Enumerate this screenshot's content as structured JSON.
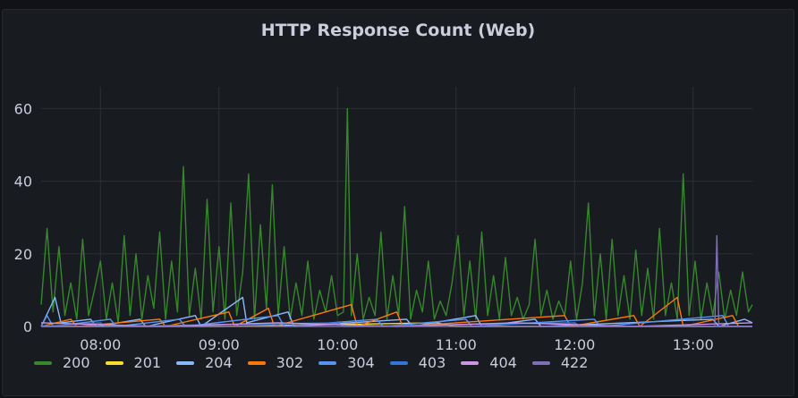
{
  "panel": {
    "title": "HTTP Response Count (Web)"
  },
  "chart_data": {
    "type": "line",
    "title": "HTTP Response Count (Web)",
    "xlabel": "",
    "ylabel": "",
    "ylim": [
      0,
      66
    ],
    "yticks": [
      0,
      20,
      40,
      60
    ],
    "xlim": [
      "07:30",
      "13:30"
    ],
    "xticks": [
      "08:00",
      "09:00",
      "10:00",
      "11:00",
      "12:00",
      "13:00"
    ],
    "grid": true,
    "legend_position": "bottom-left",
    "series": [
      {
        "name": "200",
        "color": "#37872d",
        "points": [
          [
            "07:30",
            6
          ],
          [
            "07:33",
            27
          ],
          [
            "07:36",
            4
          ],
          [
            "07:39",
            22
          ],
          [
            "07:42",
            3
          ],
          [
            "07:45",
            12
          ],
          [
            "07:48",
            2
          ],
          [
            "07:51",
            24
          ],
          [
            "07:54",
            3
          ],
          [
            "07:57",
            10
          ],
          [
            "08:00",
            18
          ],
          [
            "08:03",
            2
          ],
          [
            "08:06",
            12
          ],
          [
            "08:09",
            1
          ],
          [
            "08:12",
            25
          ],
          [
            "08:15",
            3
          ],
          [
            "08:18",
            20
          ],
          [
            "08:21",
            2
          ],
          [
            "08:24",
            14
          ],
          [
            "08:27",
            5
          ],
          [
            "08:30",
            26
          ],
          [
            "08:33",
            2
          ],
          [
            "08:36",
            18
          ],
          [
            "08:39",
            4
          ],
          [
            "08:42",
            44
          ],
          [
            "08:45",
            3
          ],
          [
            "08:48",
            16
          ],
          [
            "08:51",
            2
          ],
          [
            "08:54",
            35
          ],
          [
            "08:57",
            4
          ],
          [
            "09:00",
            22
          ],
          [
            "09:03",
            2
          ],
          [
            "09:06",
            34
          ],
          [
            "09:09",
            3
          ],
          [
            "09:12",
            15
          ],
          [
            "09:15",
            42
          ],
          [
            "09:18",
            2
          ],
          [
            "09:21",
            28
          ],
          [
            "09:24",
            5
          ],
          [
            "09:27",
            39
          ],
          [
            "09:30",
            3
          ],
          [
            "09:33",
            22
          ],
          [
            "09:36",
            2
          ],
          [
            "09:39",
            12
          ],
          [
            "09:42",
            3
          ],
          [
            "09:45",
            18
          ],
          [
            "09:48",
            2
          ],
          [
            "09:51",
            10
          ],
          [
            "09:54",
            4
          ],
          [
            "09:57",
            14
          ],
          [
            "10:00",
            3
          ],
          [
            "10:03",
            4
          ],
          [
            "10:05",
            60
          ],
          [
            "10:07",
            3
          ],
          [
            "10:10",
            20
          ],
          [
            "10:13",
            2
          ],
          [
            "10:16",
            8
          ],
          [
            "10:19",
            3
          ],
          [
            "10:22",
            26
          ],
          [
            "10:25",
            2
          ],
          [
            "10:28",
            14
          ],
          [
            "10:31",
            3
          ],
          [
            "10:34",
            33
          ],
          [
            "10:37",
            2
          ],
          [
            "10:40",
            10
          ],
          [
            "10:43",
            4
          ],
          [
            "10:46",
            18
          ],
          [
            "10:49",
            2
          ],
          [
            "10:52",
            7
          ],
          [
            "10:55",
            3
          ],
          [
            "10:58",
            12
          ],
          [
            "11:01",
            25
          ],
          [
            "11:04",
            3
          ],
          [
            "11:07",
            18
          ],
          [
            "11:10",
            2
          ],
          [
            "11:13",
            26
          ],
          [
            "11:16",
            3
          ],
          [
            "11:19",
            14
          ],
          [
            "11:22",
            2
          ],
          [
            "11:25",
            19
          ],
          [
            "11:28",
            3
          ],
          [
            "11:31",
            8
          ],
          [
            "11:34",
            2
          ],
          [
            "11:37",
            6
          ],
          [
            "11:40",
            24
          ],
          [
            "11:43",
            3
          ],
          [
            "11:46",
            10
          ],
          [
            "11:49",
            2
          ],
          [
            "11:52",
            7
          ],
          [
            "11:55",
            3
          ],
          [
            "11:58",
            18
          ],
          [
            "12:01",
            2
          ],
          [
            "12:04",
            12
          ],
          [
            "12:07",
            34
          ],
          [
            "12:10",
            3
          ],
          [
            "12:13",
            20
          ],
          [
            "12:16",
            2
          ],
          [
            "12:19",
            24
          ],
          [
            "12:22",
            3
          ],
          [
            "12:25",
            14
          ],
          [
            "12:28",
            2
          ],
          [
            "12:31",
            21
          ],
          [
            "12:34",
            3
          ],
          [
            "12:37",
            16
          ],
          [
            "12:40",
            2
          ],
          [
            "12:43",
            27
          ],
          [
            "12:46",
            3
          ],
          [
            "12:49",
            12
          ],
          [
            "12:52",
            2
          ],
          [
            "12:55",
            42
          ],
          [
            "12:58",
            3
          ],
          [
            "13:01",
            18
          ],
          [
            "13:04",
            2
          ],
          [
            "13:07",
            12
          ],
          [
            "13:10",
            3
          ],
          [
            "13:13",
            15
          ],
          [
            "13:16",
            2
          ],
          [
            "13:19",
            10
          ],
          [
            "13:22",
            3
          ],
          [
            "13:25",
            15
          ],
          [
            "13:28",
            4
          ],
          [
            "13:30",
            6
          ]
        ]
      },
      {
        "name": "201",
        "color": "#fade2a",
        "points": [
          [
            "07:30",
            0
          ],
          [
            "09:00",
            0
          ],
          [
            "10:50",
            1
          ],
          [
            "11:00",
            0
          ],
          [
            "12:30",
            0
          ],
          [
            "13:30",
            0
          ]
        ]
      },
      {
        "name": "204",
        "color": "#8ab8ff",
        "points": [
          [
            "07:30",
            0
          ],
          [
            "07:37",
            8
          ],
          [
            "07:40",
            1
          ],
          [
            "07:55",
            2
          ],
          [
            "07:58",
            0
          ],
          [
            "08:20",
            2
          ],
          [
            "08:23",
            0
          ],
          [
            "08:48",
            3
          ],
          [
            "08:51",
            0
          ],
          [
            "09:12",
            8
          ],
          [
            "09:14",
            1
          ],
          [
            "09:35",
            4
          ],
          [
            "09:38",
            0
          ],
          [
            "10:35",
            2
          ],
          [
            "10:38",
            0
          ],
          [
            "11:10",
            3
          ],
          [
            "11:13",
            0
          ],
          [
            "11:40",
            2
          ],
          [
            "11:43",
            0
          ],
          [
            "13:10",
            2
          ],
          [
            "13:13",
            0
          ],
          [
            "13:26",
            2
          ],
          [
            "13:30",
            1
          ]
        ]
      },
      {
        "name": "302",
        "color": "#ff780a",
        "points": [
          [
            "07:30",
            0
          ],
          [
            "07:45",
            2
          ],
          [
            "07:48",
            0
          ],
          [
            "08:30",
            2
          ],
          [
            "08:33",
            0
          ],
          [
            "09:05",
            4
          ],
          [
            "09:08",
            0
          ],
          [
            "09:25",
            5
          ],
          [
            "09:28",
            0
          ],
          [
            "10:07",
            6
          ],
          [
            "10:10",
            0
          ],
          [
            "10:30",
            4
          ],
          [
            "10:33",
            0
          ],
          [
            "11:55",
            3
          ],
          [
            "11:58",
            0
          ],
          [
            "12:30",
            3
          ],
          [
            "12:33",
            0
          ],
          [
            "12:52",
            8
          ],
          [
            "12:55",
            0
          ],
          [
            "13:20",
            3
          ],
          [
            "13:23",
            0
          ],
          [
            "13:30",
            0
          ]
        ]
      },
      {
        "name": "304",
        "color": "#5794f2",
        "points": [
          [
            "07:30",
            0
          ],
          [
            "07:33",
            3
          ],
          [
            "07:36",
            0
          ],
          [
            "08:05",
            2
          ],
          [
            "08:08",
            0
          ],
          [
            "08:40",
            2
          ],
          [
            "08:43",
            0
          ],
          [
            "09:30",
            3
          ],
          [
            "09:33",
            0
          ],
          [
            "10:20",
            2
          ],
          [
            "10:23",
            0
          ],
          [
            "11:05",
            2
          ],
          [
            "11:08",
            0
          ],
          [
            "12:10",
            2
          ],
          [
            "12:13",
            0
          ],
          [
            "13:15",
            3
          ],
          [
            "13:18",
            0
          ],
          [
            "13:30",
            0
          ]
        ]
      },
      {
        "name": "403",
        "color": "#3274d9",
        "points": [
          [
            "07:30",
            0
          ],
          [
            "08:00",
            1
          ],
          [
            "08:03",
            0
          ],
          [
            "10:00",
            1
          ],
          [
            "10:03",
            0
          ],
          [
            "12:00",
            1
          ],
          [
            "12:03",
            0
          ],
          [
            "13:30",
            0
          ]
        ]
      },
      {
        "name": "404",
        "color": "#ca95e5",
        "points": [
          [
            "07:30",
            1
          ],
          [
            "08:30",
            0
          ],
          [
            "09:30",
            1
          ],
          [
            "10:30",
            0
          ],
          [
            "11:30",
            1
          ],
          [
            "12:30",
            0
          ],
          [
            "13:30",
            1
          ]
        ]
      },
      {
        "name": "422",
        "color": "#806eb7",
        "points": [
          [
            "07:30",
            0
          ],
          [
            "13:11",
            0
          ],
          [
            "13:12",
            25
          ],
          [
            "13:13",
            0
          ],
          [
            "13:30",
            0
          ]
        ]
      }
    ]
  }
}
